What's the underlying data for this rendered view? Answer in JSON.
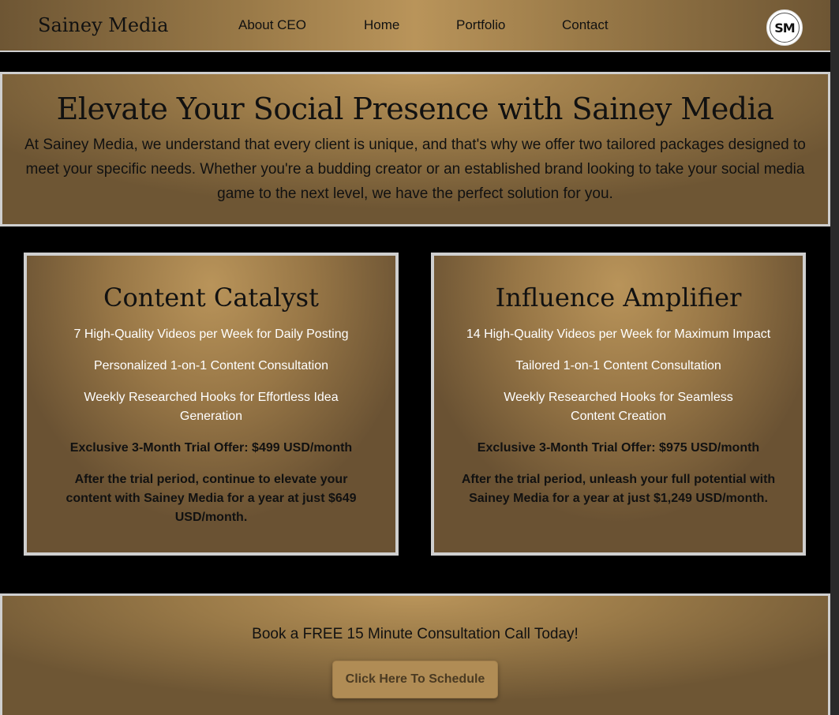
{
  "header": {
    "brand": "Sainey Media",
    "nav": [
      "About CEO",
      "Home",
      "Portfolio",
      "Contact"
    ],
    "logo_text": "SM"
  },
  "hero": {
    "title": "Elevate Your Social Presence with Sainey Media",
    "text": "At Sainey Media, we understand that every client is unique, and that's why we offer two tailored packages designed to meet your specific needs. Whether you're a budding creator or an established brand looking to take your social media game to the next level, we have the perfect solution for you."
  },
  "packages": [
    {
      "title": "Content Catalyst",
      "features": [
        "7 High-Quality Videos per Week for Daily Posting",
        "Personalized 1-on-1 Content Consultation",
        "Weekly Researched Hooks for Effortless Idea Generation"
      ],
      "offer": "Exclusive 3-Month Trial Offer: $499 USD/month",
      "after": "After the trial period, continue to elevate your content with Sainey Media for a year at just $649 USD/month."
    },
    {
      "title": "Influence Amplifier",
      "features": [
        "14 High-Quality Videos per Week for Maximum Impact",
        "Tailored 1-on-1 Content Consultation",
        "Weekly Researched Hooks for Seamless Content Creation"
      ],
      "offer": "Exclusive 3-Month Trial Offer: $975 USD/month",
      "after": "After the trial period, unleash your full potential with Sainey Media for a year at just $1,249 USD/month."
    }
  ],
  "cta": {
    "text": "Book a FREE 15 Minute Consultation Call Today!",
    "button": "Click Here To Schedule"
  }
}
